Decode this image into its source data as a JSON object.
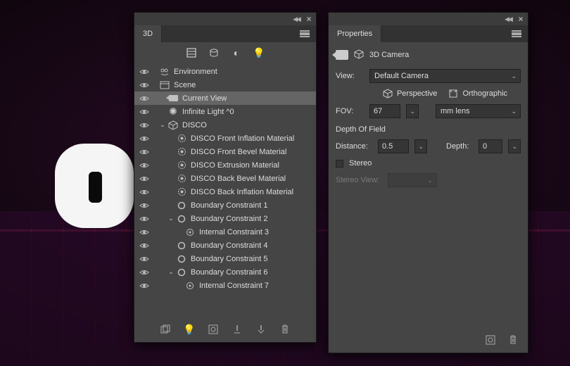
{
  "panel3d": {
    "tab": "3D",
    "footer_icons": [
      "layers",
      "bulb",
      "camera-plus",
      "light-plus",
      "object-plus",
      "trash"
    ]
  },
  "tree": [
    {
      "depth": 0,
      "eye": true,
      "arrow": "",
      "icon": "env",
      "label": "Environment"
    },
    {
      "depth": 0,
      "eye": true,
      "arrow": "",
      "icon": "scene",
      "label": "Scene"
    },
    {
      "depth": 1,
      "eye": true,
      "arrow": "",
      "icon": "camera",
      "label": "Current View",
      "selected": true
    },
    {
      "depth": 1,
      "eye": true,
      "arrow": "",
      "icon": "light",
      "label": "Infinite Light ^0"
    },
    {
      "depth": 1,
      "eye": true,
      "arrow": "down",
      "icon": "mesh",
      "label": "DISCO"
    },
    {
      "depth": 2,
      "eye": true,
      "arrow": "",
      "icon": "mat",
      "label": "DISCO Front Inflation Material"
    },
    {
      "depth": 2,
      "eye": true,
      "arrow": "",
      "icon": "mat",
      "label": "DISCO Front Bevel Material"
    },
    {
      "depth": 2,
      "eye": true,
      "arrow": "",
      "icon": "mat",
      "label": "DISCO Extrusion Material"
    },
    {
      "depth": 2,
      "eye": true,
      "arrow": "",
      "icon": "mat",
      "label": "DISCO Back Bevel Material"
    },
    {
      "depth": 2,
      "eye": true,
      "arrow": "",
      "icon": "mat",
      "label": "DISCO Back Inflation Material"
    },
    {
      "depth": 2,
      "eye": true,
      "arrow": "",
      "icon": "ring",
      "label": "Boundary Constraint 1"
    },
    {
      "depth": 2,
      "eye": true,
      "arrow": "down",
      "icon": "ring",
      "label": "Boundary Constraint 2"
    },
    {
      "depth": 3,
      "eye": true,
      "arrow": "",
      "icon": "target",
      "label": "Internal Constraint 3"
    },
    {
      "depth": 2,
      "eye": true,
      "arrow": "",
      "icon": "ring",
      "label": "Boundary Constraint 4"
    },
    {
      "depth": 2,
      "eye": true,
      "arrow": "",
      "icon": "ring",
      "label": "Boundary Constraint 5"
    },
    {
      "depth": 2,
      "eye": true,
      "arrow": "down",
      "icon": "ring",
      "label": "Boundary Constraint 6"
    },
    {
      "depth": 3,
      "eye": true,
      "arrow": "",
      "icon": "target",
      "label": "Internal Constraint 7"
    }
  ],
  "properties": {
    "tab": "Properties",
    "title": "3D Camera",
    "view_label": "View:",
    "view_value": "Default Camera",
    "perspective": "Perspective",
    "orthographic": "Orthographic",
    "fov_label": "FOV:",
    "fov_value": "67",
    "fov_unit": "mm lens",
    "dof_header": "Depth Of Field",
    "distance_label": "Distance:",
    "distance_value": "0.5",
    "depth_label": "Depth:",
    "depth_value": "0",
    "stereo_label": "Stereo",
    "stereo_view_label": "Stereo View:"
  }
}
